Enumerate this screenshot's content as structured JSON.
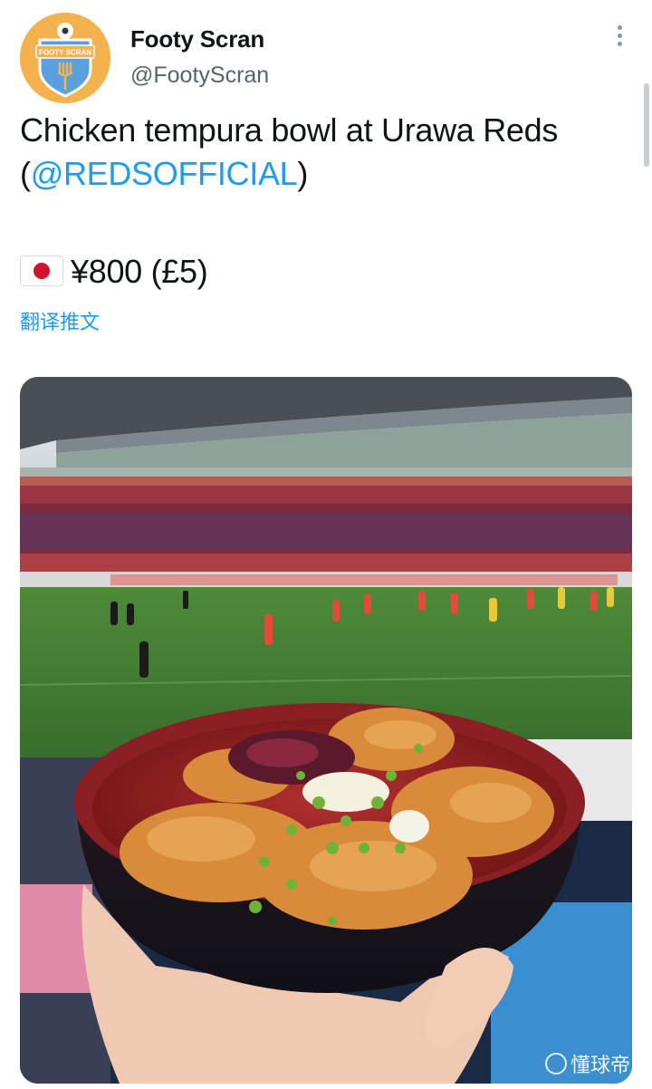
{
  "tweet": {
    "display_name": "Footy Scran",
    "handle": "@FootyScran",
    "text_line_1": "Chicken tempura bowl at Urawa Reds",
    "text_line_2_open": "(",
    "mention": "@REDSOFFICIAL",
    "text_line_2_close": ")",
    "price": "¥800 (£5)",
    "flag": "japan-flag",
    "translate_label": "翻译推文"
  },
  "avatar": {
    "badge_text": "FOOTY SCRAN",
    "colors": {
      "background": "#f4b24e",
      "shield": "#4a90d9"
    }
  },
  "media": {
    "watermark": "懂球帝"
  },
  "colors": {
    "link": "#1d9bf0",
    "secondary_text": "#536471"
  }
}
